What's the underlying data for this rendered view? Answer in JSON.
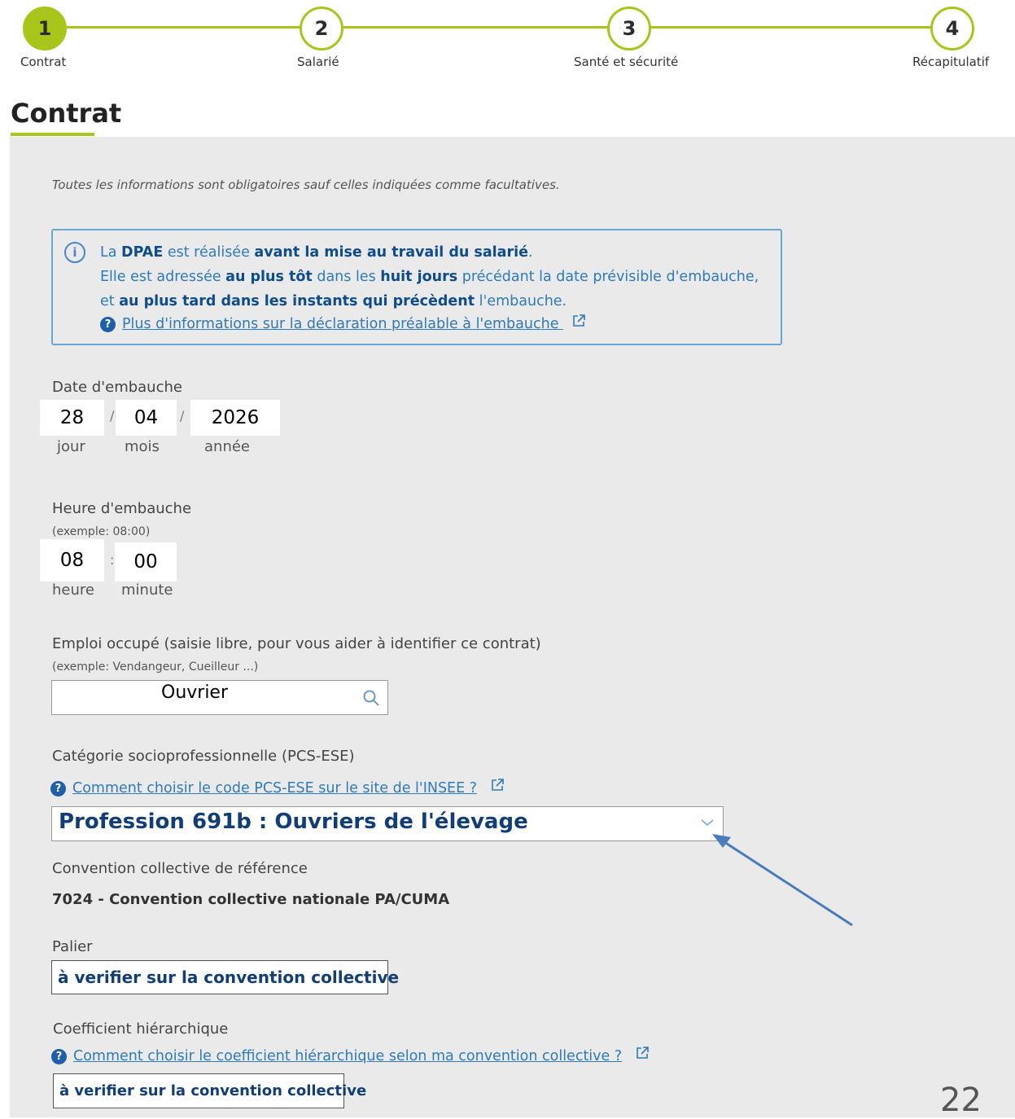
{
  "stepper": {
    "steps": [
      {
        "number": "1",
        "label": "Contrat"
      },
      {
        "number": "2",
        "label": "Salarié"
      },
      {
        "number": "3",
        "label": "Santé et sécurité"
      },
      {
        "number": "4",
        "label": "Récapitulatif"
      }
    ]
  },
  "page": {
    "title": "Contrat",
    "intro": "Toutes les informations sont obligatoires sauf celles indiquées comme facultatives.",
    "page_number": "22"
  },
  "info": {
    "p1": "La ",
    "b1": "DPAE",
    "p2": " est réalisée ",
    "b2": "avant la mise au travail du salarié",
    "p3": ".",
    "p4": "Elle est adressée ",
    "b3": "au plus tôt",
    "p5": " dans les ",
    "b4": "huit jours",
    "p6": " précédant la date prévisible d'embauche, et ",
    "b5": "au plus tard dans les instants qui précèdent",
    "p7": " l'embauche.",
    "link": "Plus d'informations sur la déclaration préalable à l'embauche"
  },
  "hire_date": {
    "label": "Date d'embauche",
    "day": "28",
    "month": "04",
    "year": "2026",
    "day_label": "jour",
    "month_label": "mois",
    "year_label": "année",
    "separator": "/"
  },
  "hire_time": {
    "label": "Heure d'embauche",
    "hint": "(exemple: 08:00)",
    "hour": "08",
    "minute": "00",
    "hour_label": "heure",
    "minute_label": "minute",
    "separator": ":"
  },
  "job": {
    "label": "Emploi occupé (saisie libre, pour vous aider à identifier ce contrat)",
    "hint": "(exemple: Vendangeur, Cueilleur ...)",
    "value": "Ouvrier"
  },
  "category": {
    "label": "Catégorie socioprofessionnelle (PCS-ESE)",
    "help_link": "Comment choisir le code PCS-ESE sur le site de l'INSEE ?",
    "selected": "Profession 691b : Ouvriers de l'élevage"
  },
  "convention": {
    "label": "Convention collective de référence",
    "value": "7024 - Convention collective nationale PA/CUMA"
  },
  "palier": {
    "label": "Palier",
    "value": "à verifier sur la convention collective"
  },
  "coefficient": {
    "label": "Coefficient hiérarchique",
    "help_link": "Comment choisir le coefficient hiérarchique selon ma convention collective ?",
    "value": "à verifier sur la convention collective"
  },
  "colors": {
    "accent_green": "#a8c51c",
    "link_blue": "#2f7ab8",
    "value_navy": "#123e78",
    "annotation_arrow": "#4a7bbd"
  },
  "icons": {
    "info": "info-circle-icon",
    "help": "question-circle-icon",
    "external": "external-link-icon",
    "search": "search-icon",
    "dropdown": "chevron-down-icon"
  }
}
